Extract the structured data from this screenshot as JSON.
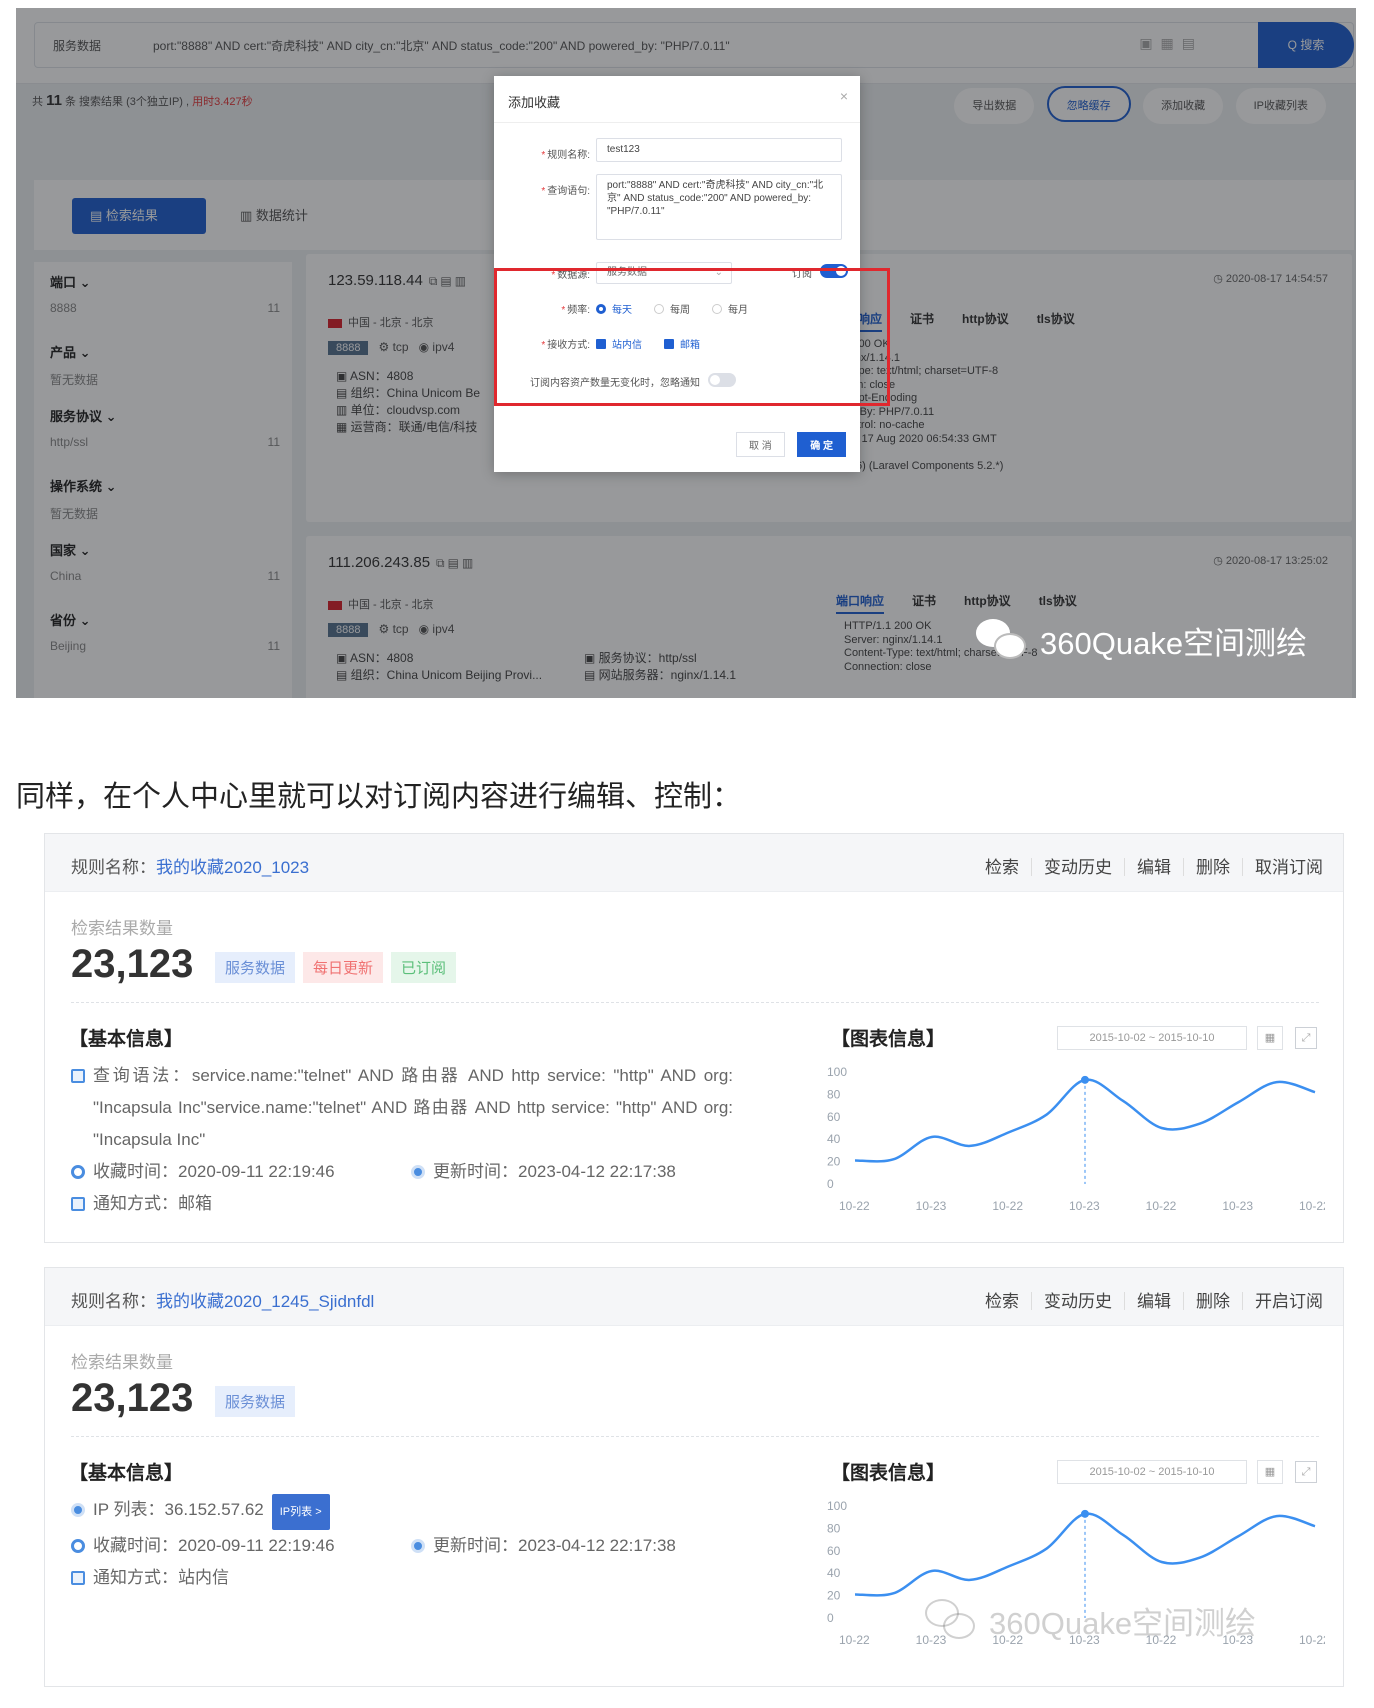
{
  "screenshot": {
    "scope": "服务数据",
    "query": "port:\"8888\" AND cert:\"奇虎科技\" AND city_cn:\"北京\" AND status_code:\"200\" AND powered_by: \"PHP/7.0.11\"",
    "search_button": "Q 搜索",
    "result_count": {
      "prefix": "共",
      "num": "11",
      "unit": "条",
      "desc": "搜索结果 (3个独立IP)",
      "elapsed": "用时3.427秒"
    },
    "toolbar": [
      "导出数据",
      "忽略缓存",
      "添加收藏",
      "IP收藏列表"
    ],
    "tabs": [
      "检索结果",
      "数据统计"
    ],
    "facets": [
      {
        "title": "端口",
        "value": "8888",
        "count": "11"
      },
      {
        "title": "产品",
        "value": "暂无数据",
        "count": ""
      },
      {
        "title": "服务协议",
        "value": "http/ssl",
        "count": "11"
      },
      {
        "title": "操作系统",
        "value": "暂无数据",
        "count": ""
      },
      {
        "title": "国家",
        "value": "China",
        "count": "11"
      },
      {
        "title": "省份",
        "value": "Beijing",
        "count": "11"
      }
    ],
    "results": [
      {
        "ip": "123.59.118.44",
        "time": "2020-08-17 14:54:57",
        "location": "中国 - 北京 - 北京",
        "port": "8888",
        "transport": "tcp",
        "ipver": "ipv4",
        "meta": [
          "ASN：4808",
          "组织：China Unicom Be",
          "单位：cloudvsp.com",
          "运营商：联通/电信/科技"
        ],
        "meta2": [],
        "proto_tabs": [
          "端口响应",
          "证书",
          "http协议",
          "tls协议"
        ],
        "response": "1.1 200 OK\n: nginx/1.14.1\nnt-Type: text/html; charset=UTF-8\nection: close\nAccept-Encoding\nered-By: PHP/7.0.11\n-Control: no-cache\nMon, 17 Aug 2020 06:54:33 GMT\n\n(5.2.6) (Laravel Components 5.2.*)"
      },
      {
        "ip": "111.206.243.85",
        "time": "2020-08-17 13:25:02",
        "location": "中国 - 北京 - 北京",
        "port": "8888",
        "transport": "tcp",
        "ipver": "ipv4",
        "meta": [
          "ASN：4808",
          "组织：China Unicom Beijing Provi..."
        ],
        "meta2": [
          "服务协议：http/ssl",
          "网站服务器：nginx/1.14.1"
        ],
        "proto_tabs": [
          "端口响应",
          "证书",
          "http协议",
          "tls协议"
        ],
        "response": "HTTP/1.1 200 OK\nServer: nginx/1.14.1\nContent-Type: text/html; charset=UTF-8\nConnection: close"
      }
    ],
    "modal": {
      "title": "添加收藏",
      "close": "×",
      "rule_name_label": "规则名称:",
      "rule_name_value": "test123",
      "query_label": "查询语句:",
      "query_value": "port:\"8888\" AND cert:\"奇虎科技\" AND city_cn:\"北京\" AND status_code:\"200\" AND powered_by: \"PHP/7.0.11\"",
      "source_label": "数据源:",
      "source_value": "服务数据",
      "subscribe_label": "订阅",
      "freq_label": "频率:",
      "freq_options": [
        "每天",
        "每周",
        "每月"
      ],
      "receive_label": "接收方式:",
      "receive_options": [
        "站内信",
        "邮箱"
      ],
      "note": "订阅内容资产数量无变化时，忽略通知",
      "cancel": "取 消",
      "confirm": "确 定"
    },
    "watermark": "360Quake空间测绘"
  },
  "caption": "同样，在个人中心里就可以对订阅内容进行编辑、控制：",
  "rules": [
    {
      "title_label": "规则名称：",
      "title_value": "我的收藏2020_1023",
      "actions": [
        "检索",
        "变动历史",
        "编辑",
        "删除",
        "取消订阅"
      ],
      "count_label": "检索结果数量",
      "count": "23,123",
      "badges": [
        {
          "text": "服务数据",
          "kind": "blue"
        },
        {
          "text": "每日更新",
          "kind": "red"
        },
        {
          "text": "已订阅",
          "kind": "green"
        }
      ],
      "basic_title": "【基本信息】",
      "chart_title": "【图表信息】",
      "syntax_label": "查询语法：",
      "syntax_value": "service.name:\"telnet\" AND 路由器 AND http service: \"http\" AND org: \"Incapsula Inc\"service.name:\"telnet\" AND 路由器 AND http service: \"http\" AND org: \"Incapsula Inc\"",
      "fav_time_label": "收藏时间：",
      "fav_time": "2020-09-11 22:19:46",
      "update_label": "更新时间：",
      "update_time": "2023-04-12 22:17:38",
      "notify_label": "通知方式：",
      "notify_value": "邮箱",
      "date_range": "2015-10-02 ~ 2015-10-10"
    },
    {
      "title_label": "规则名称：",
      "title_value": "我的收藏2020_1245_Sjidnfdl",
      "actions": [
        "检索",
        "变动历史",
        "编辑",
        "删除",
        "开启订阅"
      ],
      "count_label": "检索结果数量",
      "count": "23,123",
      "badges": [
        {
          "text": "服务数据",
          "kind": "blue"
        }
      ],
      "basic_title": "【基本信息】",
      "chart_title": "【图表信息】",
      "ip_label": "IP 列表：",
      "ip_value": "36.152.57.62",
      "ip_button": "IP列表 >",
      "fav_time_label": "收藏时间：",
      "fav_time": "2020-09-11 22:19:46",
      "update_label": "更新时间：",
      "update_time": "2023-04-12 22:17:38",
      "notify_label": "通知方式：",
      "notify_value": "站内信",
      "date_range": "2015-10-02 ~ 2015-10-10"
    }
  ],
  "chart_data": [
    {
      "type": "line",
      "categories": [
        "10-22",
        "10-23",
        "10-22",
        "10-23",
        "10-22",
        "10-23",
        "10-22"
      ],
      "x": [
        0,
        0.5,
        1,
        1.5,
        2,
        2.5,
        3,
        3.5,
        4,
        4.5,
        5,
        5.5,
        6
      ],
      "values": [
        21,
        22,
        42,
        34,
        46,
        62,
        93,
        74,
        50,
        54,
        73,
        91,
        82
      ],
      "yticks": [
        "100",
        "80",
        "60",
        "40",
        "20",
        "0"
      ],
      "ylim": [
        0,
        100
      ],
      "highlight_index": 6,
      "color": "#3b8ff0"
    },
    {
      "type": "line",
      "categories": [
        "10-22",
        "10-23",
        "10-22",
        "10-23",
        "10-22",
        "10-23",
        "10-22"
      ],
      "x": [
        0,
        0.5,
        1,
        1.5,
        2,
        2.5,
        3,
        3.5,
        4,
        4.5,
        5,
        5.5,
        6
      ],
      "values": [
        21,
        22,
        42,
        34,
        46,
        62,
        93,
        74,
        50,
        54,
        73,
        91,
        82
      ],
      "yticks": [
        "100",
        "80",
        "60",
        "40",
        "20",
        "0"
      ],
      "ylim": [
        0,
        100
      ],
      "highlight_index": 6,
      "color": "#3b8ff0"
    }
  ]
}
